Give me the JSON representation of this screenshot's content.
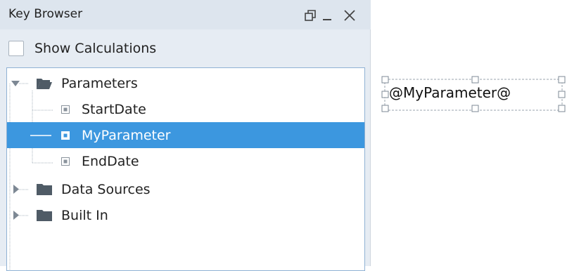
{
  "window": {
    "title": "Key Browser",
    "controls": [
      "restore-icon",
      "minimize-icon",
      "close-icon"
    ]
  },
  "options": {
    "show_calculations_label": "Show Calculations",
    "show_calculations_checked": false
  },
  "tree": {
    "nodes": [
      {
        "label": "Parameters",
        "icon": "folder-open-icon",
        "expanded": true
      },
      {
        "label": "StartDate",
        "icon": "parameter-icon"
      },
      {
        "label": "MyParameter",
        "icon": "parameter-icon",
        "selected": true
      },
      {
        "label": "EndDate",
        "icon": "parameter-icon"
      },
      {
        "label": "Data Sources",
        "icon": "folder-icon",
        "expanded": false
      },
      {
        "label": "Built In",
        "icon": "folder-icon",
        "expanded": false
      }
    ]
  },
  "canvas": {
    "label_text": "@MyParameter@"
  },
  "colors": {
    "selection": "#3c97df",
    "panel_bg": "#e6ecf3",
    "tree_border": "#8fb1d4"
  }
}
